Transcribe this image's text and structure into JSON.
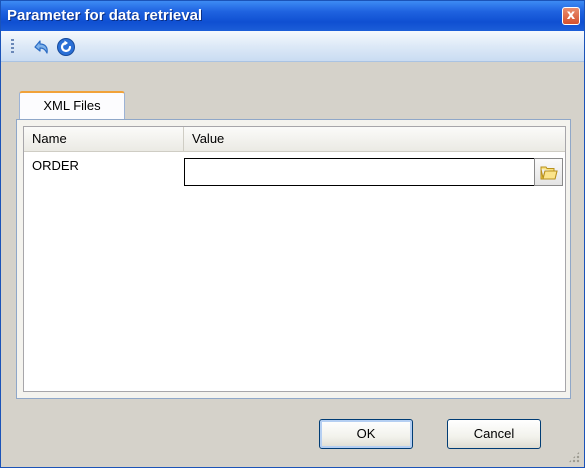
{
  "window": {
    "title": "Parameter for data retrieval",
    "close_label": "x"
  },
  "toolbar": {
    "buttons": [
      {
        "icon": "undo-icon"
      },
      {
        "icon": "refresh-icon"
      }
    ]
  },
  "tabs": [
    {
      "label": "XML Files",
      "selected": true
    }
  ],
  "grid": {
    "columns": [
      "Name",
      "Value"
    ],
    "rows": [
      {
        "name": "ORDER",
        "value": "",
        "browse_icon": "folder-icon"
      }
    ]
  },
  "buttons": {
    "ok_label": "OK",
    "cancel_label": "Cancel"
  },
  "colors": {
    "titlebar": "#0f4fd2",
    "close_button": "#d5502d",
    "tab_accent": "#f1a239"
  }
}
